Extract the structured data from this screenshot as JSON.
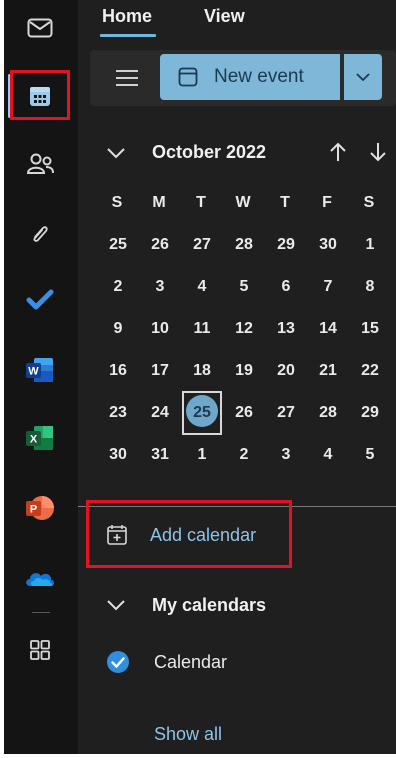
{
  "nav_rail": {
    "items": [
      {
        "name": "mail",
        "icon": "mail-icon"
      },
      {
        "name": "calendar",
        "icon": "calendar-icon",
        "active": true
      },
      {
        "name": "people",
        "icon": "people-icon"
      },
      {
        "name": "files",
        "icon": "paperclip-icon"
      },
      {
        "name": "todo",
        "icon": "todo-check-icon"
      },
      {
        "name": "word",
        "icon": "word-icon",
        "letter": "W"
      },
      {
        "name": "excel",
        "icon": "excel-icon",
        "letter": "X"
      },
      {
        "name": "powerpoint",
        "icon": "powerpoint-icon",
        "letter": "P"
      },
      {
        "name": "onedrive",
        "icon": "onedrive-cloud-icon"
      },
      {
        "name": "apps",
        "icon": "apps-icon"
      }
    ]
  },
  "ribbon": {
    "tabs": [
      {
        "label": "Home",
        "selected": true
      },
      {
        "label": "View",
        "selected": false
      }
    ],
    "new_event_label": "New event"
  },
  "mini_calendar": {
    "month_title": "October 2022",
    "days_of_week": [
      "S",
      "M",
      "T",
      "W",
      "T",
      "F",
      "S"
    ],
    "weeks": [
      [
        "25",
        "26",
        "27",
        "28",
        "29",
        "30",
        "1"
      ],
      [
        "2",
        "3",
        "4",
        "5",
        "6",
        "7",
        "8"
      ],
      [
        "9",
        "10",
        "11",
        "12",
        "13",
        "14",
        "15"
      ],
      [
        "16",
        "17",
        "18",
        "19",
        "20",
        "21",
        "22"
      ],
      [
        "23",
        "24",
        "25",
        "26",
        "27",
        "28",
        "29"
      ],
      [
        "30",
        "31",
        "1",
        "2",
        "3",
        "4",
        "5"
      ]
    ],
    "today": {
      "week": 4,
      "day": 2
    }
  },
  "sidebar": {
    "add_calendar_label": "Add calendar",
    "my_calendars_label": "My calendars",
    "calendar_item_label": "Calendar",
    "show_all_label": "Show all"
  },
  "colors": {
    "accent": "#7fb7d8",
    "link": "#8fc3e6",
    "highlight_box": "#e81123",
    "background": "#1f1f1f",
    "rail": "#141414"
  }
}
